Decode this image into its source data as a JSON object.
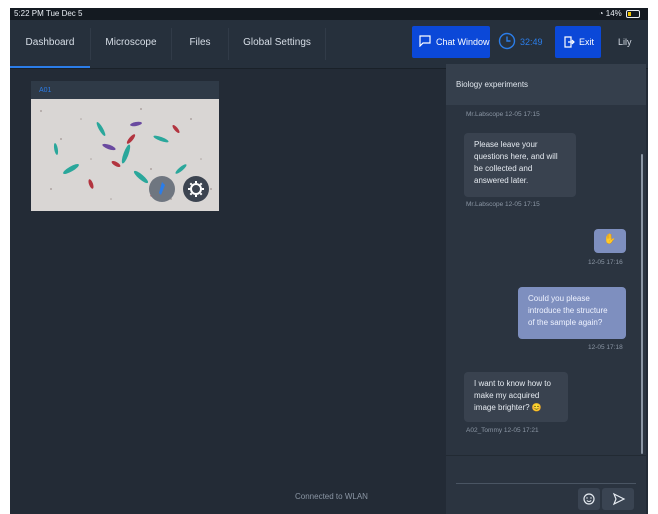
{
  "status_bar": {
    "time": "5:22 PM  Tue Dec 5",
    "battery": "14%"
  },
  "nav": {
    "tabs": [
      {
        "label": "Dashboard"
      },
      {
        "label": "Microscope"
      },
      {
        "label": "Files"
      },
      {
        "label": "Global Settings"
      }
    ],
    "chat_window_label": "Chat Window",
    "timer": "32:49",
    "exit_label": "Exit",
    "user": "Lily"
  },
  "dashboard": {
    "card_label": "A01",
    "footer": "Connected to WLAN"
  },
  "chat": {
    "title": "Biology experiments",
    "messages": [
      {
        "meta": "Mr.Labscope  12-05 17:15"
      },
      {
        "text_lines": [
          "Please leave your",
          "questions here, and will",
          "be collected and",
          "answered later."
        ],
        "meta": "Mr.Labscope  12-05 17:15"
      },
      {
        "text": "✋",
        "meta": "12-05 17:16"
      },
      {
        "text_lines": [
          "Could you please",
          "introduce the structure",
          "of the sample again?"
        ],
        "meta": "12-05 17:18"
      },
      {
        "text_lines": [
          "I want to know how to",
          "make my acquired",
          "image brighter? 😊"
        ],
        "meta": "A02_Tommy  12-05 17:21"
      }
    ]
  },
  "colors": {
    "accent": "#0b48d8",
    "panel": "#2b3440",
    "background": "#232b36"
  },
  "icons": {
    "chat": "chat-icon",
    "timer": "clock-icon",
    "exit": "exit-icon",
    "emoji": "smile-icon",
    "send": "send-icon",
    "pen": "pen-icon",
    "settings": "gear-icon"
  }
}
